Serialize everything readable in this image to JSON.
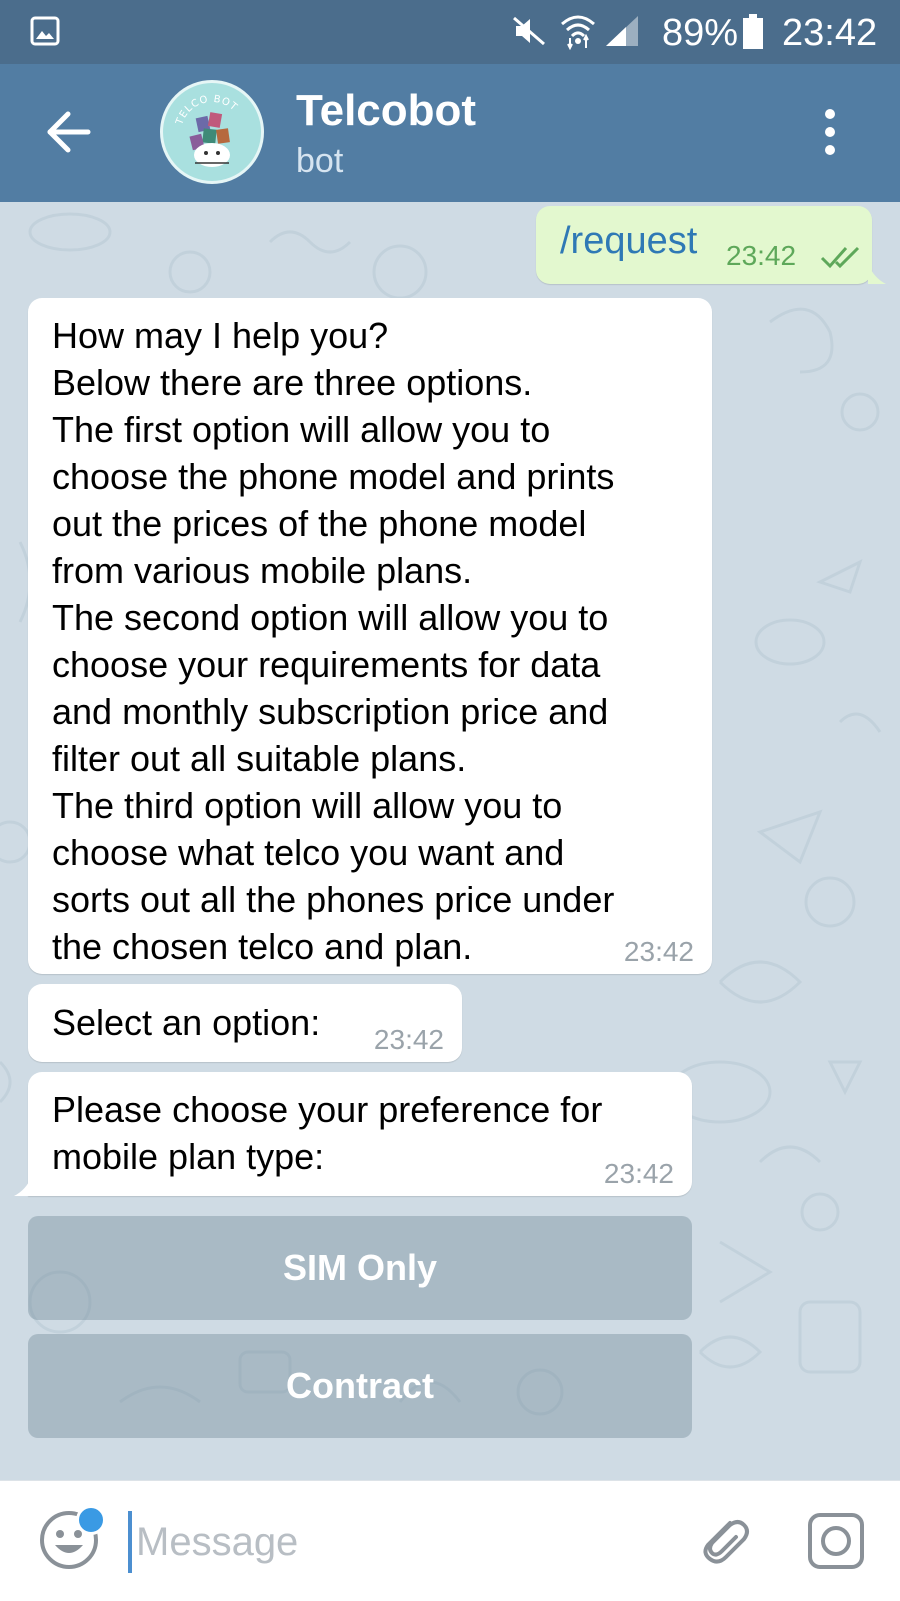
{
  "status_bar": {
    "battery_pct": "89%",
    "time": "23:42",
    "icons": [
      "gallery-icon",
      "mute-icon",
      "wifi-icon",
      "signal-icon",
      "battery-icon"
    ]
  },
  "header": {
    "title": "Telcobot",
    "subtitle": "bot",
    "avatar_text": "TELCO BOT"
  },
  "messages": [
    {
      "direction": "out",
      "text": "/request",
      "time": "23:42",
      "status": "read"
    },
    {
      "direction": "in",
      "lines": [
        "How may I help you?",
        "Below there are three options.",
        "The first option will allow you to",
        "choose the phone model and prints",
        "out the prices of the phone model",
        "from various mobile plans.",
        "The second option will allow you to",
        "choose your requirements for data",
        "and monthly subscription price and",
        "filter out all suitable plans.",
        "The third option will allow you to",
        "choose what telco you want and",
        "sorts out all the phones price under",
        "the chosen telco and plan."
      ],
      "time": "23:42"
    },
    {
      "direction": "in",
      "text": "Select an option:",
      "time": "23:42"
    },
    {
      "direction": "in",
      "lines": [
        "Please choose your preference for",
        "mobile plan type:"
      ],
      "time": "23:42"
    }
  ],
  "keyboard": {
    "buttons": [
      "SIM Only",
      "Contract"
    ]
  },
  "input": {
    "placeholder": "Message"
  },
  "colors": {
    "status_bar": "#4b6d8c",
    "header": "#527da3",
    "chat_bg": "#cfdbe4",
    "outgoing_bubble": "#e3f8cf",
    "incoming_bubble": "#ffffff"
  }
}
